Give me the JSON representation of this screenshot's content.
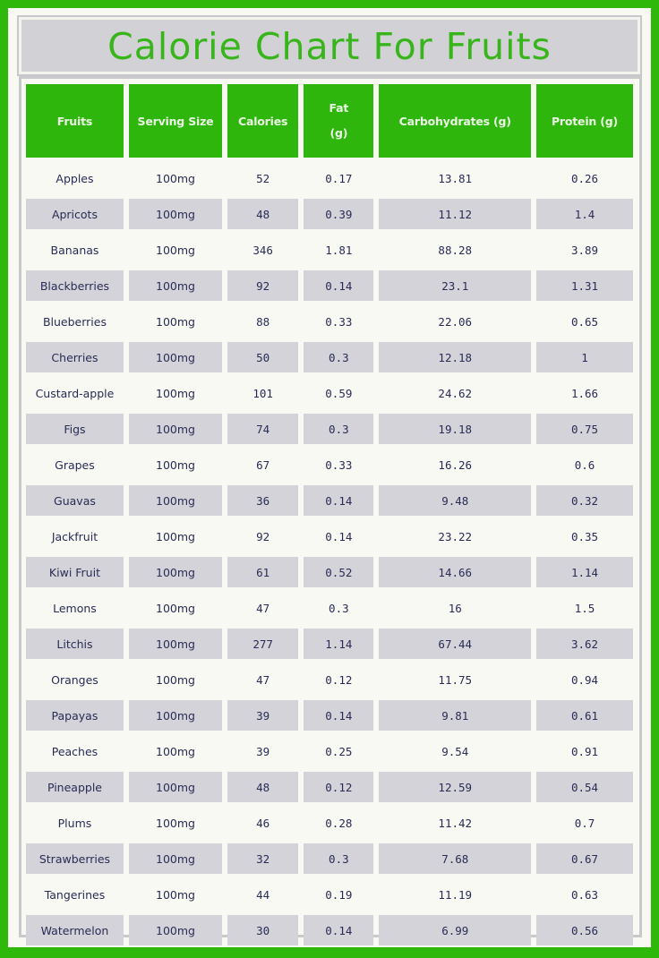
{
  "title": "Calorie Chart For Fruits",
  "colors": {
    "brand_green": "#2fb80c",
    "title_green": "#38b51b",
    "alt_row": "#d3d3d9",
    "text": "#2a2c56"
  },
  "table": {
    "headers": {
      "fruits": "Fruits",
      "serving_size": "Serving Size",
      "calories": "Calories",
      "fat_line1": "Fat",
      "fat_line2": "(g)",
      "carbohydrates": "Carbohydrates (g)",
      "protein": "Protein (g)"
    },
    "rows": [
      {
        "fruit": "Apples",
        "serving": "100mg",
        "calories": "52",
        "fat": "0.17",
        "carbs": "13.81",
        "protein": "0.26"
      },
      {
        "fruit": "Apricots",
        "serving": "100mg",
        "calories": "48",
        "fat": "0.39",
        "carbs": "11.12",
        "protein": "1.4"
      },
      {
        "fruit": "Bananas",
        "serving": "100mg",
        "calories": "346",
        "fat": "1.81",
        "carbs": "88.28",
        "protein": "3.89"
      },
      {
        "fruit": "Blackberries",
        "serving": "100mg",
        "calories": "92",
        "fat": "0.14",
        "carbs": "23.1",
        "protein": "1.31"
      },
      {
        "fruit": "Blueberries",
        "serving": "100mg",
        "calories": "88",
        "fat": "0.33",
        "carbs": "22.06",
        "protein": "0.65"
      },
      {
        "fruit": "Cherries",
        "serving": "100mg",
        "calories": "50",
        "fat": "0.3",
        "carbs": "12.18",
        "protein": "1"
      },
      {
        "fruit": "Custard-apple",
        "serving": "100mg",
        "calories": "101",
        "fat": "0.59",
        "carbs": "24.62",
        "protein": "1.66"
      },
      {
        "fruit": "Figs",
        "serving": "100mg",
        "calories": "74",
        "fat": "0.3",
        "carbs": "19.18",
        "protein": "0.75"
      },
      {
        "fruit": "Grapes",
        "serving": "100mg",
        "calories": "67",
        "fat": "0.33",
        "carbs": "16.26",
        "protein": "0.6"
      },
      {
        "fruit": "Guavas",
        "serving": "100mg",
        "calories": "36",
        "fat": "0.14",
        "carbs": "9.48",
        "protein": "0.32"
      },
      {
        "fruit": "Jackfruit",
        "serving": "100mg",
        "calories": "92",
        "fat": "0.14",
        "carbs": "23.22",
        "protein": "0.35"
      },
      {
        "fruit": "Kiwi Fruit",
        "serving": "100mg",
        "calories": "61",
        "fat": "0.52",
        "carbs": "14.66",
        "protein": "1.14"
      },
      {
        "fruit": "Lemons",
        "serving": "100mg",
        "calories": "47",
        "fat": "0.3",
        "carbs": "16",
        "protein": "1.5"
      },
      {
        "fruit": "Litchis",
        "serving": "100mg",
        "calories": "277",
        "fat": "1.14",
        "carbs": "67.44",
        "protein": "3.62"
      },
      {
        "fruit": "Oranges",
        "serving": "100mg",
        "calories": "47",
        "fat": "0.12",
        "carbs": "11.75",
        "protein": "0.94"
      },
      {
        "fruit": "Papayas",
        "serving": "100mg",
        "calories": "39",
        "fat": "0.14",
        "carbs": "9.81",
        "protein": "0.61"
      },
      {
        "fruit": "Peaches",
        "serving": "100mg",
        "calories": "39",
        "fat": "0.25",
        "carbs": "9.54",
        "protein": "0.91"
      },
      {
        "fruit": "Pineapple",
        "serving": "100mg",
        "calories": "48",
        "fat": "0.12",
        "carbs": "12.59",
        "protein": "0.54"
      },
      {
        "fruit": "Plums",
        "serving": "100mg",
        "calories": "46",
        "fat": "0.28",
        "carbs": "11.42",
        "protein": "0.7"
      },
      {
        "fruit": "Strawberries",
        "serving": "100mg",
        "calories": "32",
        "fat": "0.3",
        "carbs": "7.68",
        "protein": "0.67"
      },
      {
        "fruit": "Tangerines",
        "serving": "100mg",
        "calories": "44",
        "fat": "0.19",
        "carbs": "11.19",
        "protein": "0.63"
      },
      {
        "fruit": "Watermelon",
        "serving": "100mg",
        "calories": "30",
        "fat": "0.14",
        "carbs": "6.99",
        "protein": "0.56"
      }
    ]
  }
}
